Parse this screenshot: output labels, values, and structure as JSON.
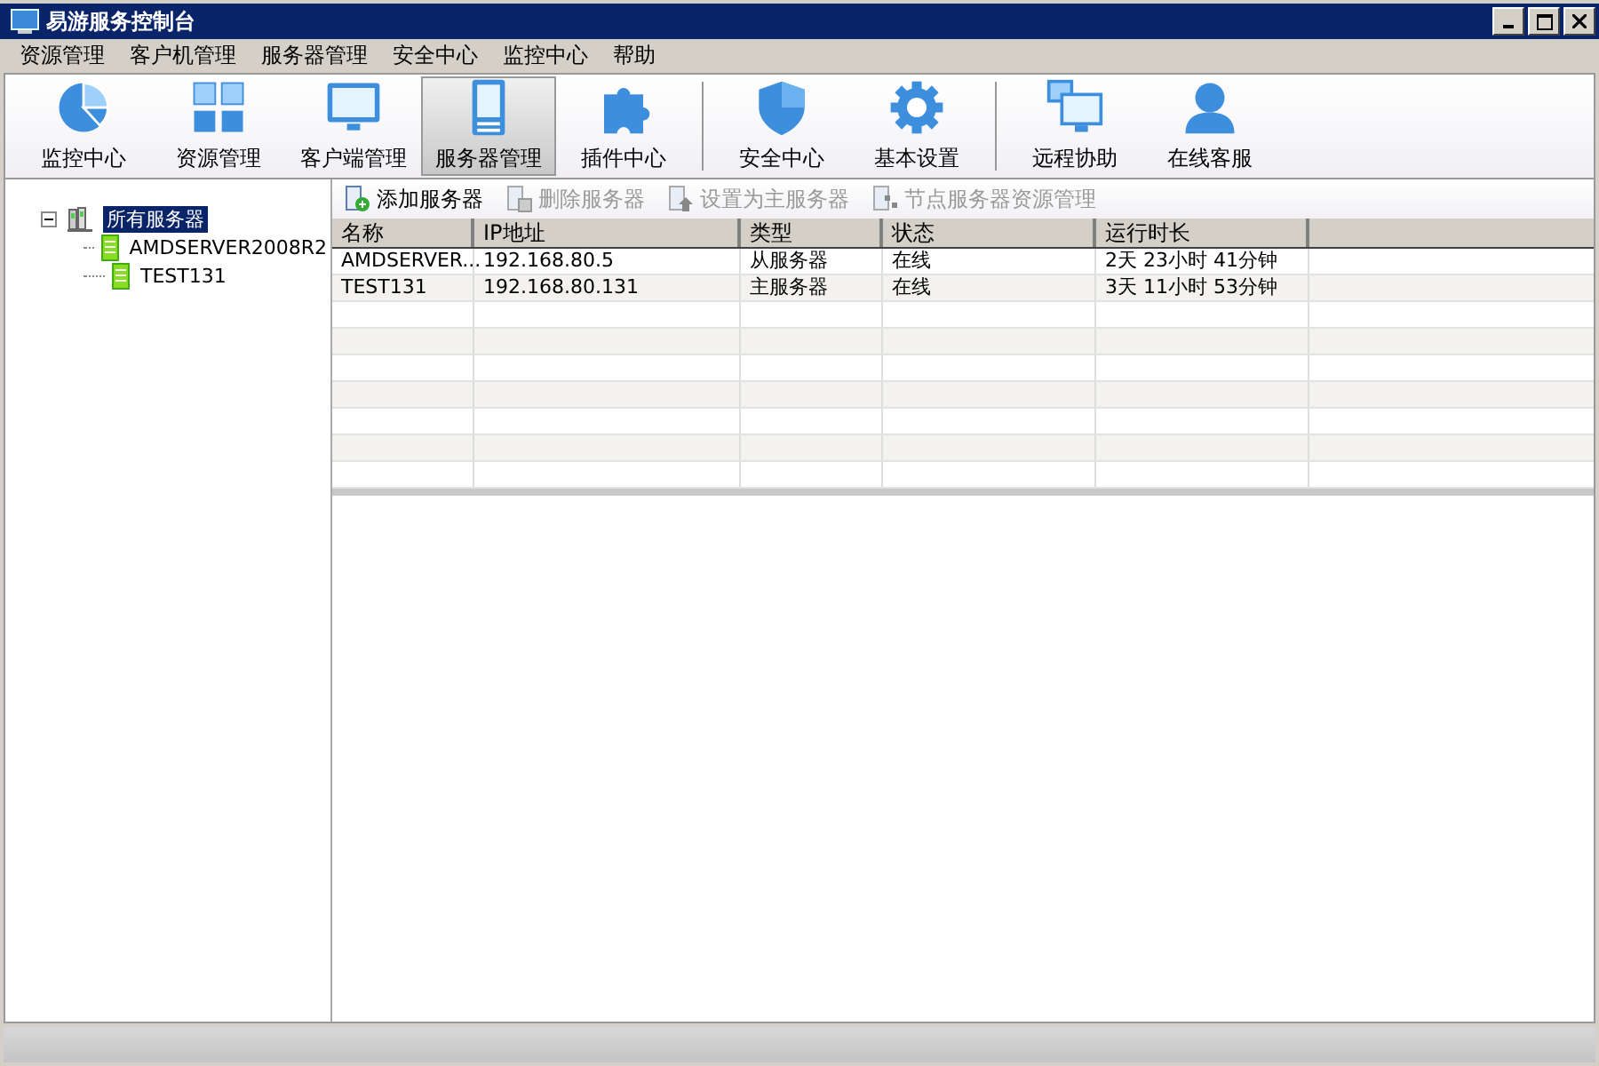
{
  "window": {
    "title": "易游服务控制台"
  },
  "menu": [
    "资源管理",
    "客户机管理",
    "服务器管理",
    "安全中心",
    "监控中心",
    "帮助"
  ],
  "toolbar": [
    {
      "label": "监控中心",
      "kind": "pie",
      "selected": false,
      "separator_after": false
    },
    {
      "label": "资源管理",
      "kind": "grid",
      "selected": false,
      "separator_after": false
    },
    {
      "label": "客户端管理",
      "kind": "monitor",
      "selected": false,
      "separator_after": false
    },
    {
      "label": "服务器管理",
      "kind": "server",
      "selected": true,
      "separator_after": false
    },
    {
      "label": "插件中心",
      "kind": "puzzle",
      "selected": false,
      "separator_after": true
    },
    {
      "label": "安全中心",
      "kind": "shield",
      "selected": false,
      "separator_after": false
    },
    {
      "label": "基本设置",
      "kind": "gear",
      "selected": false,
      "separator_after": true
    },
    {
      "label": "远程协助",
      "kind": "remote",
      "selected": false,
      "separator_after": false
    },
    {
      "label": "在线客服",
      "kind": "person",
      "selected": false,
      "separator_after": false
    }
  ],
  "tree": {
    "label": "所有服务器",
    "expanded": true,
    "selected": true,
    "children": [
      {
        "label": "AMDSERVER2008R2"
      },
      {
        "label": "TEST131"
      }
    ]
  },
  "actions": [
    {
      "label": "添加服务器",
      "disabled": false
    },
    {
      "label": "删除服务器",
      "disabled": true
    },
    {
      "label": "设置为主服务器",
      "disabled": true
    },
    {
      "label": "节点服务器资源管理",
      "disabled": true
    }
  ],
  "table": {
    "columns": [
      "名称",
      "IP地址",
      "类型",
      "状态",
      "运行时长"
    ],
    "rows": [
      [
        "AMDSERVER...",
        "192.168.80.5",
        "从服务器",
        "在线",
        "2天 23小时 41分钟"
      ],
      [
        "TEST131",
        "192.168.80.131",
        "主服务器",
        "在线",
        "3天 11小时 53分钟"
      ]
    ]
  }
}
